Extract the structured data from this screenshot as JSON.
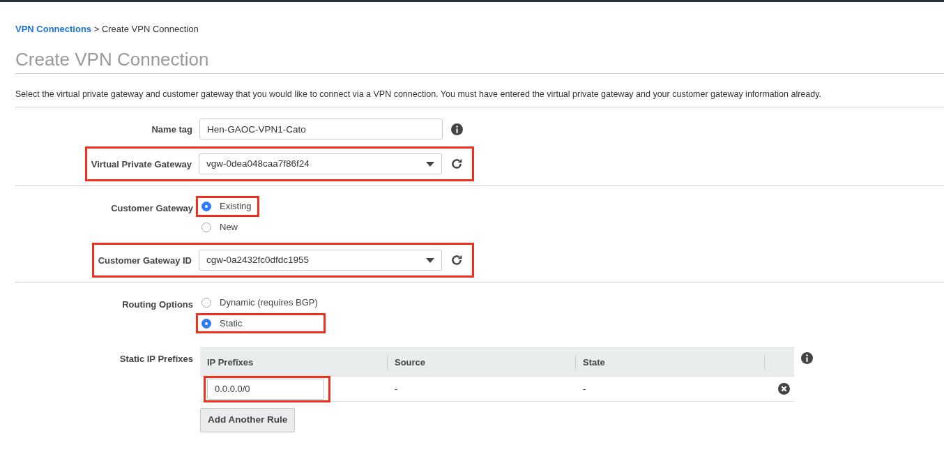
{
  "breadcrumb": {
    "link": "VPN Connections",
    "separator": ">",
    "current": "Create VPN Connection"
  },
  "title": "Create VPN Connection",
  "description": "Select the virtual private gateway and customer gateway that you would like to connect via a VPN connection. You must have entered the virtual private gateway and your customer gateway information already.",
  "sections": [
    {
      "fields": [
        {
          "kind": "text",
          "label": "Name tag",
          "value": "Hen-GAOC-VPN1-Cato",
          "highlighted": false
        },
        {
          "kind": "select",
          "label": "Virtual Private Gateway",
          "value": "vgw-0dea048caa7f86f24",
          "highlighted": true
        }
      ]
    },
    {
      "fields": [
        {
          "kind": "radio",
          "label": "Customer Gateway",
          "options": [
            {
              "label": "Existing",
              "selected": true,
              "highlighted": true
            },
            {
              "label": "New",
              "selected": false,
              "highlighted": false
            }
          ]
        },
        {
          "kind": "select",
          "label": "Customer Gateway ID",
          "value": "cgw-0a2432fc0dfdc1955",
          "highlighted": true
        }
      ]
    },
    {
      "fields": [
        {
          "kind": "radio",
          "label": "Routing Options",
          "options": [
            {
              "label": "Dynamic (requires BGP)",
              "selected": false,
              "highlighted": false
            },
            {
              "label": "Static",
              "selected": true,
              "highlighted": true
            }
          ]
        },
        {
          "kind": "table",
          "label": "Static IP Prefixes",
          "columns": [
            "IP Prefixes",
            "Source",
            "State"
          ],
          "rows": [
            {
              "prefix": "0.0.0.0/0",
              "highlighted": true,
              "source": "-",
              "state": "-"
            }
          ],
          "button": "Add Another Rule"
        }
      ]
    }
  ]
}
